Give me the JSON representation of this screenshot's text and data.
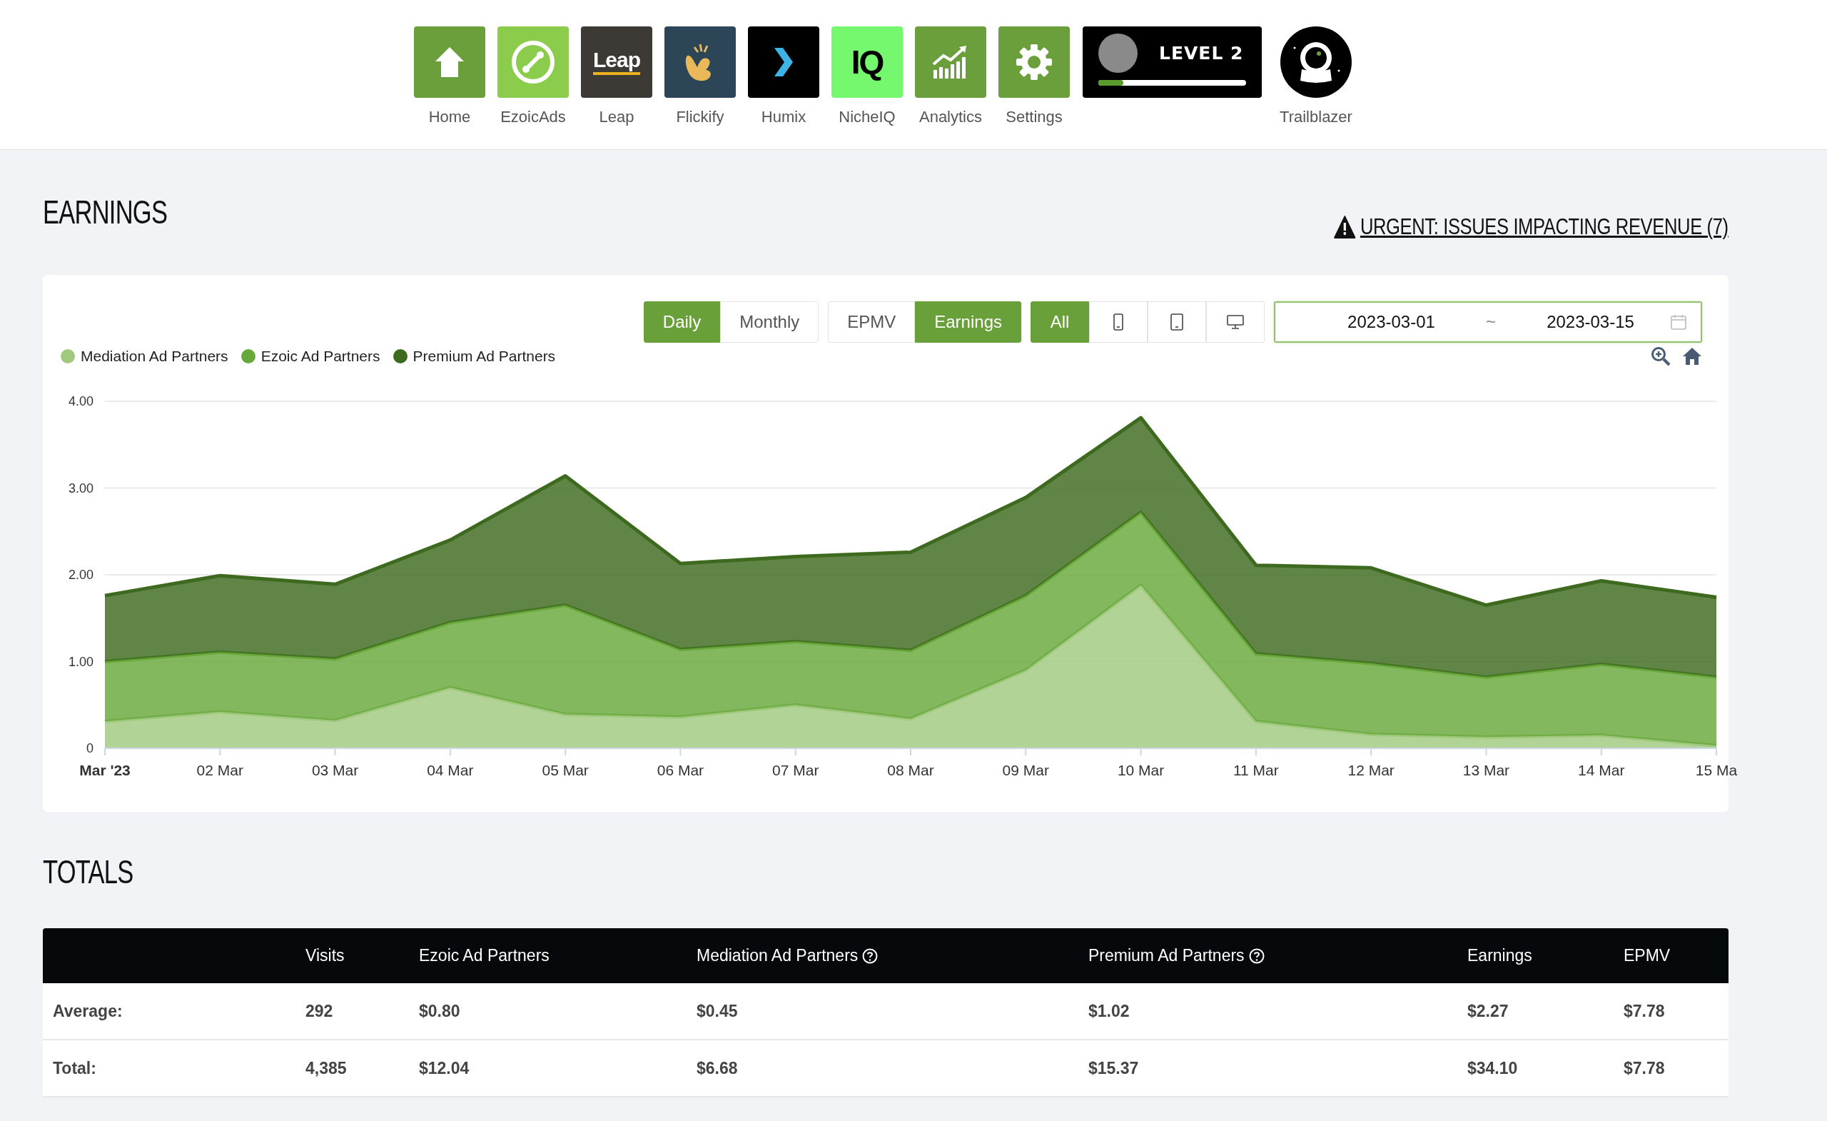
{
  "nav": {
    "apps": [
      {
        "kind": "home",
        "label": "Home"
      },
      {
        "kind": "ezoicads",
        "label": "EzoicAds"
      },
      {
        "kind": "leap",
        "label": "Leap",
        "tile_text": "Leap"
      },
      {
        "kind": "flickify",
        "label": "Flickify"
      },
      {
        "kind": "humix",
        "label": "Humix"
      },
      {
        "kind": "nicheiq",
        "label": "NicheIQ",
        "tile_text": "IQ"
      },
      {
        "kind": "analytics",
        "label": "Analytics"
      },
      {
        "kind": "settings",
        "label": "Settings"
      }
    ],
    "level_badge": {
      "text": "LEVEL 2",
      "level": 0.17
    },
    "trailblazer": {
      "label": "Trailblazer"
    }
  },
  "earnings": {
    "title": "EARNINGS",
    "alert": "URGENT: ISSUES IMPACTING REVENUE (7)",
    "period_toggle": [
      {
        "label": "Daily",
        "selected": true
      },
      {
        "label": "Monthly",
        "selected": false
      }
    ],
    "metric_toggle": [
      {
        "label": "EPMV",
        "selected": false
      },
      {
        "label": "Earnings",
        "selected": true
      }
    ],
    "device_toggle": [
      {
        "kind": "all",
        "label": "All",
        "selected": true
      },
      {
        "kind": "phone",
        "selected": false
      },
      {
        "kind": "tablet",
        "selected": false
      },
      {
        "kind": "desktop",
        "selected": false
      }
    ],
    "date_range": {
      "start": "2023-03-01",
      "separator": "~",
      "end": "2023-03-15"
    },
    "chart_data": {
      "type": "area",
      "stacked": true,
      "categories": [
        "Mar '23",
        "02 Mar",
        "03 Mar",
        "04 Mar",
        "05 Mar",
        "06 Mar",
        "07 Mar",
        "08 Mar",
        "09 Mar",
        "10 Mar",
        "11 Mar",
        "12 Mar",
        "13 Mar",
        "14 Mar",
        "15 Ma"
      ],
      "ylim": [
        0,
        4
      ],
      "yticks": [
        {
          "value": 0,
          "label": "0"
        },
        {
          "value": 1,
          "label": "1.00"
        },
        {
          "value": 2,
          "label": "2.00"
        },
        {
          "value": 3,
          "label": "3.00"
        },
        {
          "value": 4,
          "label": "4.00"
        }
      ],
      "series": [
        {
          "name": "Mediation Ad Partners",
          "color": "#a0c97e",
          "values": [
            0.31,
            0.42,
            0.32,
            0.7,
            0.39,
            0.36,
            0.5,
            0.34,
            0.9,
            1.88,
            0.31,
            0.16,
            0.13,
            0.15,
            0.03
          ]
        },
        {
          "name": "Ezoic Ad Partners",
          "color": "#68a83a",
          "values": [
            0.69,
            0.69,
            0.71,
            0.75,
            1.26,
            0.78,
            0.73,
            0.79,
            0.86,
            0.84,
            0.78,
            0.82,
            0.69,
            0.82,
            0.79
          ]
        },
        {
          "name": "Premium Ad Partners",
          "color": "#3e6a1f",
          "values": [
            0.76,
            0.88,
            0.86,
            0.95,
            1.49,
            0.99,
            0.98,
            1.13,
            1.13,
            1.09,
            1.02,
            1.1,
            0.83,
            0.96,
            0.92
          ]
        }
      ]
    }
  },
  "totals": {
    "title": "TOTALS",
    "columns": [
      {
        "label": "Visits",
        "help": false
      },
      {
        "label": "Ezoic Ad Partners",
        "help": false
      },
      {
        "label": "Mediation Ad Partners",
        "help": true
      },
      {
        "label": "Premium Ad Partners",
        "help": true
      },
      {
        "label": "Earnings",
        "help": false
      },
      {
        "label": "EPMV",
        "help": false
      }
    ],
    "rows": [
      {
        "label": "Average:",
        "cells": [
          "292",
          "$0.80",
          "$0.45",
          "$1.02",
          "$2.27",
          "$7.78"
        ]
      },
      {
        "label": "Total:",
        "cells": [
          "4,385",
          "$12.04",
          "$6.68",
          "$15.37",
          "$34.10",
          "$7.78"
        ]
      }
    ]
  }
}
